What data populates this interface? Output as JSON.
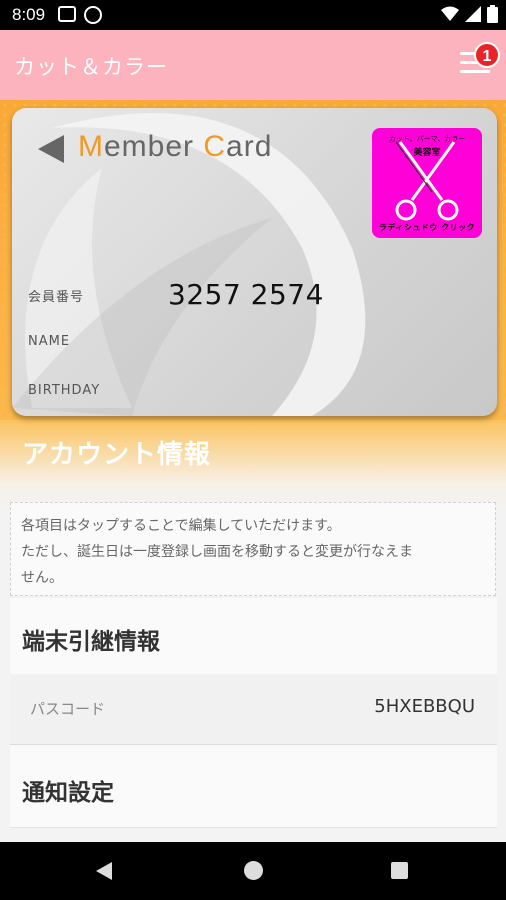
{
  "status_bar": {
    "time": "8:09",
    "icons": [
      "mail-icon",
      "sync-icon",
      "wifi-icon",
      "signal-icon",
      "battery-icon"
    ]
  },
  "app_bar": {
    "title": "カット＆カラー",
    "notification_count": "1",
    "menu_icon": "hamburger-menu-icon"
  },
  "member_card": {
    "title_prefix": "M",
    "title_part1": "ember ",
    "title_c": "C",
    "title_part2": "ard",
    "logo_top": "カット、パーマ、カラー",
    "logo_mid": "美容室",
    "logo_bottom": "ラディシュドウ クリック",
    "member_number_label": "会員番号",
    "member_number": "3257 2574",
    "name_label": "NAME",
    "birthday_label": "BIRTHDAY",
    "accent_color": "#f09a25",
    "logo_color": "#ff00d8"
  },
  "account": {
    "title": "アカウント情報",
    "notice_line1": "各項目はタップすることで編集していただけます。",
    "notice_line2": "ただし、誕生日は一度登録し画面を移動すると変更が行なえま",
    "notice_line3": "せん。"
  },
  "transfer": {
    "title": "端末引継情報",
    "passcode_label": "パスコード",
    "passcode_value": "5HXEBBQU"
  },
  "notifications": {
    "title": "通知設定"
  },
  "colors": {
    "app_bar": "#fdb3bd",
    "header_orange": "#f9a938",
    "badge": "#e8232a"
  }
}
